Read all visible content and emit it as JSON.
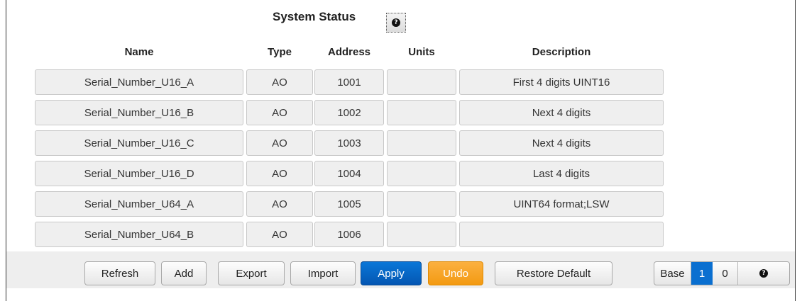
{
  "title": "System Status",
  "columns": {
    "name": "Name",
    "type": "Type",
    "address": "Address",
    "units": "Units",
    "description": "Description"
  },
  "rows": [
    {
      "name": "Serial_Number_U16_A",
      "type": "AO",
      "address": "1001",
      "units": "",
      "description": "First 4 digits UINT16"
    },
    {
      "name": "Serial_Number_U16_B",
      "type": "AO",
      "address": "1002",
      "units": "",
      "description": "Next 4 digits"
    },
    {
      "name": "Serial_Number_U16_C",
      "type": "AO",
      "address": "1003",
      "units": "",
      "description": "Next 4 digits"
    },
    {
      "name": "Serial_Number_U16_D",
      "type": "AO",
      "address": "1004",
      "units": "",
      "description": "Last 4 digits"
    },
    {
      "name": "Serial_Number_U64_A",
      "type": "AO",
      "address": "1005",
      "units": "",
      "description": "UINT64 format;LSW"
    },
    {
      "name": "Serial_Number_U64_B",
      "type": "AO",
      "address": "1006",
      "units": "",
      "description": ""
    }
  ],
  "toolbar": {
    "refresh": "Refresh",
    "add": "Add",
    "export": "Export",
    "import": "Import",
    "apply": "Apply",
    "undo": "Undo",
    "restore_default": "Restore Default"
  },
  "base": {
    "label": "Base",
    "option_1": "1",
    "option_0": "0",
    "selected": "1"
  },
  "colors": {
    "apply": "#0a6fd0",
    "undo": "#f5a623",
    "base_selected": "#0a6fd0",
    "footer_bg": "#eeeeee"
  },
  "icons": {
    "help": "question-circle-icon"
  }
}
